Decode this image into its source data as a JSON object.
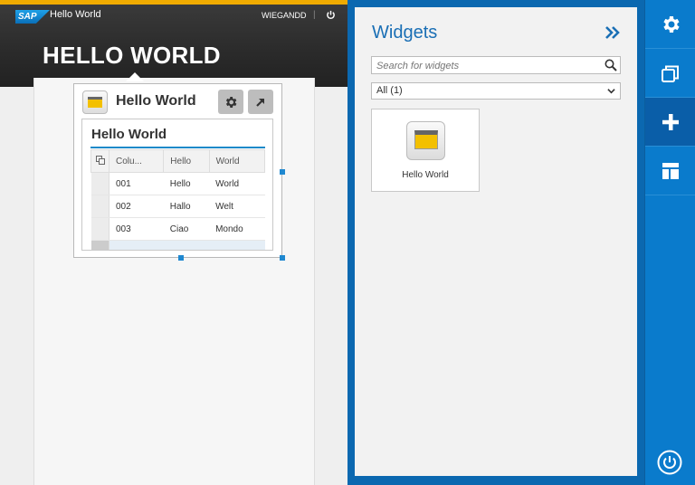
{
  "shell": {
    "logo": "SAP",
    "app_title": "Hello World",
    "user": "WIEGANDD",
    "separator": "|",
    "page_title": "HELLO WORLD"
  },
  "widget": {
    "title": "Hello World",
    "table": {
      "title": "Hello World",
      "columns": [
        "Colu...",
        "Hello",
        "World"
      ],
      "rows": [
        [
          "001",
          "Hello",
          "World"
        ],
        [
          "002",
          "Hallo",
          "Welt"
        ],
        [
          "003",
          "Ciao",
          "Mondo"
        ]
      ]
    }
  },
  "pane": {
    "title": "Widgets",
    "search_placeholder": "Search for widgets",
    "filter_value": "All (1)",
    "tiles": [
      {
        "label": "Hello World",
        "icon": "widget-window-icon"
      }
    ]
  },
  "sidebar": {
    "items": [
      {
        "icon": "gear-icon",
        "active": false
      },
      {
        "icon": "copy-icon",
        "active": false
      },
      {
        "icon": "plus-icon",
        "active": true
      },
      {
        "icon": "layout-icon",
        "active": false
      }
    ],
    "logout_icon": "power-icon"
  },
  "colors": {
    "accent": "#0a7bcc",
    "highlight": "#f0ab00",
    "title_blue": "#1a6fb5"
  }
}
